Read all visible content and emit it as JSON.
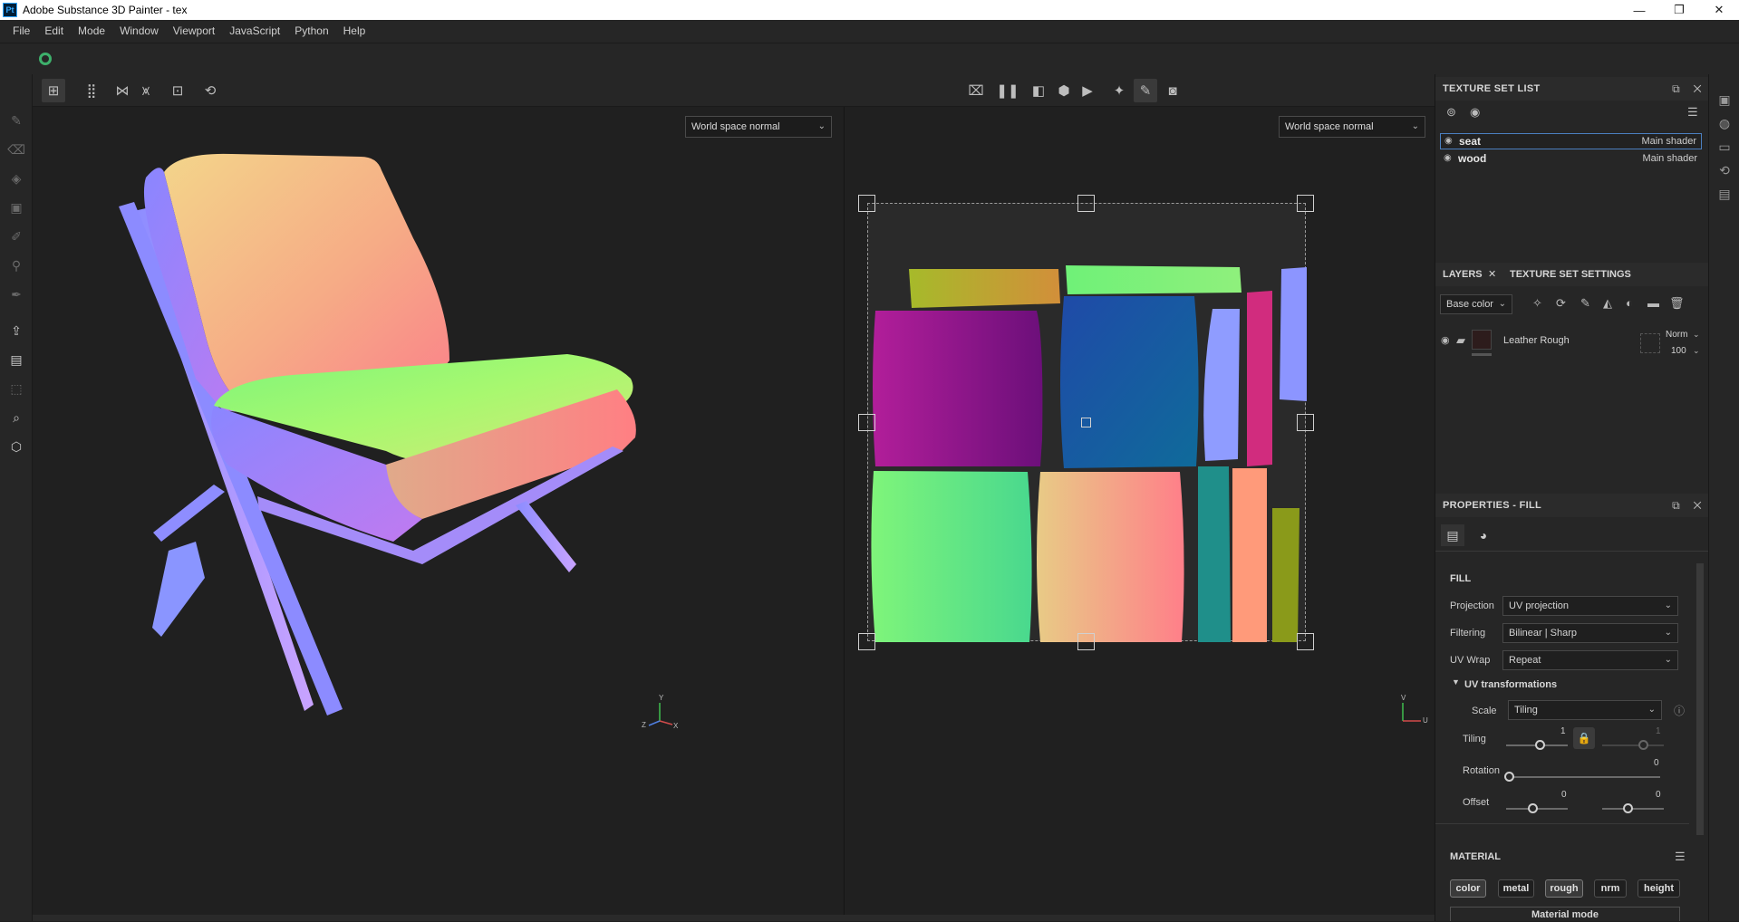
{
  "window": {
    "app_icon_text": "Pt",
    "title": "Adobe Substance 3D Painter - tex",
    "minimize": "—",
    "maximize": "❐",
    "close": "✕"
  },
  "menu": [
    "File",
    "Edit",
    "Mode",
    "Window",
    "Viewport",
    "JavaScript",
    "Python",
    "Help"
  ],
  "viewport": {
    "left_mode": "World space normal",
    "right_mode": "World space normal",
    "axis_3d": {
      "y": "Y",
      "z": "Z",
      "x": "X"
    },
    "axis_2d": {
      "v": "V",
      "u": "U"
    }
  },
  "texture_set_list": {
    "title": "TEXTURE SET LIST",
    "items": [
      {
        "name": "seat",
        "shader": "Main shader",
        "selected": true
      },
      {
        "name": "wood",
        "shader": "Main shader",
        "selected": false
      }
    ]
  },
  "layers": {
    "tab_layers": "LAYERS",
    "tab_close": "✕",
    "tab_settings": "TEXTURE SET SETTINGS",
    "channel": "Base color",
    "items": [
      {
        "name": "Leather Rough",
        "blend": "Norm",
        "opacity": "100"
      }
    ]
  },
  "properties": {
    "title": "PROPERTIES - FILL",
    "section_fill": "FILL",
    "projection_label": "Projection",
    "projection_value": "UV projection",
    "filtering_label": "Filtering",
    "filtering_value": "Bilinear | Sharp",
    "uvwrap_label": "UV Wrap",
    "uvwrap_value": "Repeat",
    "uv_transformations": "UV transformations",
    "scale_label": "Scale",
    "scale_value": "Tiling",
    "tiling_label": "Tiling",
    "tiling_u": "1",
    "tiling_v": "1",
    "rotation_label": "Rotation",
    "rotation_value": "0",
    "offset_label": "Offset",
    "offset_u": "0",
    "offset_v": "0",
    "section_material": "MATERIAL",
    "material_buttons": [
      {
        "label": "color",
        "on": true
      },
      {
        "label": "metal",
        "on": false
      },
      {
        "label": "rough",
        "on": true
      },
      {
        "label": "nrm",
        "on": false
      },
      {
        "label": "height",
        "on": false
      }
    ],
    "material_mode": "Material mode"
  },
  "colors": {
    "accent_green": "#3db06b",
    "selection_blue": "#4b7fbf"
  }
}
